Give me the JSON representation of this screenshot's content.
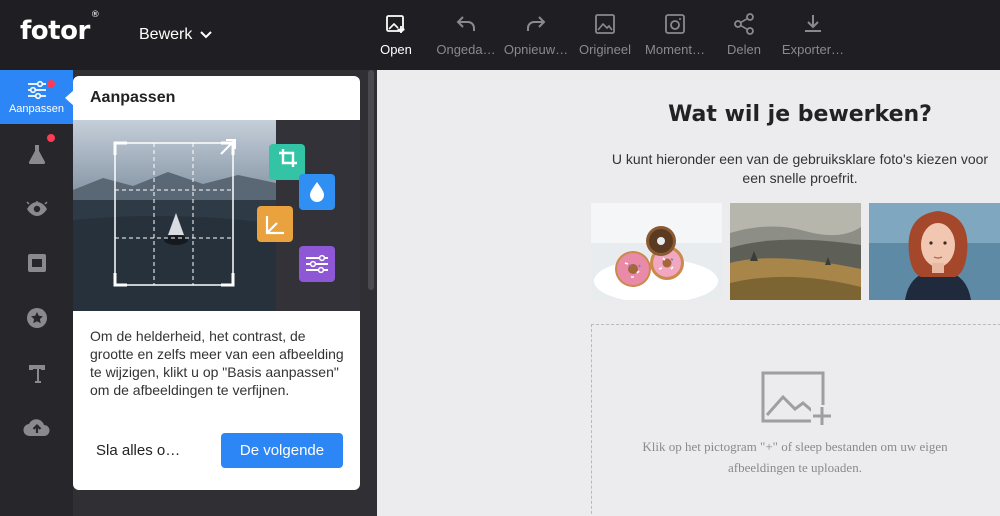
{
  "app": {
    "logo": "fotor",
    "logo_mark": "®"
  },
  "header": {
    "edit_menu": "Bewerk",
    "tools": [
      {
        "label": "Open",
        "icon": "image-plus-icon",
        "active": true
      },
      {
        "label": "Ongeda…",
        "icon": "undo-icon",
        "active": false
      },
      {
        "label": "Opnieuw…",
        "icon": "redo-icon",
        "active": false
      },
      {
        "label": "Origineel",
        "icon": "image-icon",
        "active": false
      },
      {
        "label": "Moment…",
        "icon": "camera-icon",
        "active": false
      },
      {
        "label": "Delen",
        "icon": "share-icon",
        "active": false
      },
      {
        "label": "Exporter…",
        "icon": "download-icon",
        "active": false
      }
    ]
  },
  "sidebar": {
    "items": [
      {
        "label": "Aanpassen",
        "icon": "sliders-icon",
        "active": true,
        "badge": true
      },
      {
        "label": "",
        "icon": "flask-icon",
        "active": false,
        "badge": true
      },
      {
        "label": "",
        "icon": "eye-icon",
        "active": false,
        "badge": false
      },
      {
        "label": "",
        "icon": "frame-icon",
        "active": false,
        "badge": false
      },
      {
        "label": "",
        "icon": "star-icon",
        "active": false,
        "badge": false
      },
      {
        "label": "",
        "icon": "text-icon",
        "active": false,
        "badge": false
      },
      {
        "label": "",
        "icon": "cloud-upload-icon",
        "active": false,
        "badge": false
      }
    ]
  },
  "tooltip": {
    "title": "Aanpassen",
    "body": "Om de helderheid, het contrast, de grootte en zelfs meer van een afbeelding te wijzigen, klikt u op \"Basis aanpassen\" om de afbeeldingen te verfijnen.",
    "skip_label": "Sla alles o…",
    "next_label": "De volgende"
  },
  "main": {
    "heading": "Wat wil je bewerken?",
    "subheading": "U kunt hieronder een van de gebruiksklare foto's kiezen voor een snelle proefrit.",
    "samples": [
      "donuts",
      "landscape",
      "portrait"
    ],
    "upload_text": "Klik op het pictogram \"+\" of sleep bestanden om uw eigen afbeeldingen te uploaden."
  },
  "colors": {
    "accent": "#2d86f5",
    "topbar": "#1f1f23",
    "badge": "#ff3b55"
  }
}
